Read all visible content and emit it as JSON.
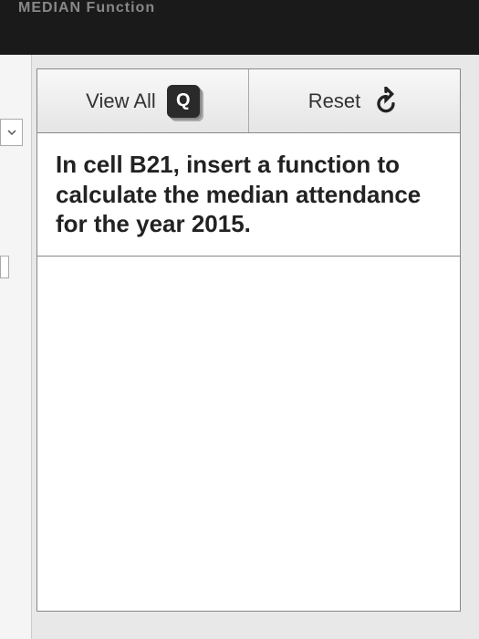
{
  "header": {
    "title": "MEDIAN Function"
  },
  "toolbar": {
    "view_all_label": "View All",
    "view_all_icon_letter": "Q",
    "reset_label": "Reset"
  },
  "instruction": {
    "text": "In cell B21, insert a function to calculate the median attendance for the year 2015."
  }
}
